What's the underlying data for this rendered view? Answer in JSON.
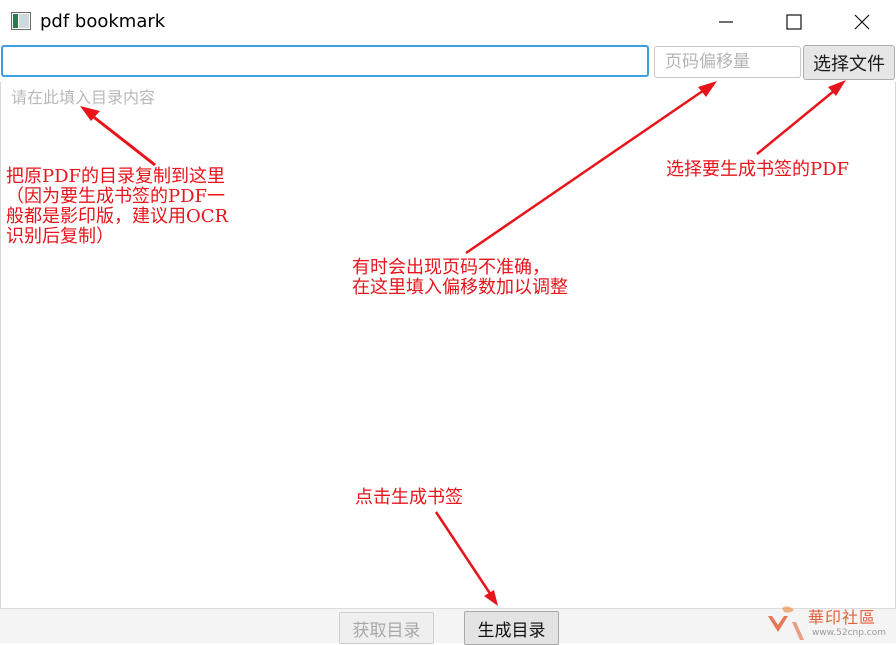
{
  "window": {
    "title": "pdf bookmark",
    "controls": [
      "minimize",
      "maximize",
      "close"
    ]
  },
  "toolbar": {
    "directory_input_value": "",
    "offset_placeholder": "页码偏移量",
    "choose_file_label": "选择文件"
  },
  "editor": {
    "placeholder": "请在此填入目录内容"
  },
  "annotations": {
    "paste_hint": [
      "把原PDF的目录复制到这里",
      "（因为要生成书签的PDF一",
      "般都是影印版，建议用OCR",
      "识别后复制）"
    ],
    "choose_file_hint": "选择要生成书签的PDF",
    "offset_hint": [
      "有时会出现页码不准确，",
      "在这里填入偏移数加以调整"
    ],
    "generate_hint": "点击生成书签"
  },
  "footer": {
    "fetch_label": "获取目录",
    "generate_label": "生成目录"
  },
  "watermark": {
    "text": "華印社區",
    "url": "www.52cnp.com"
  },
  "colors": {
    "annotation": "#e8141b",
    "focus_border": "#3aa0df"
  }
}
